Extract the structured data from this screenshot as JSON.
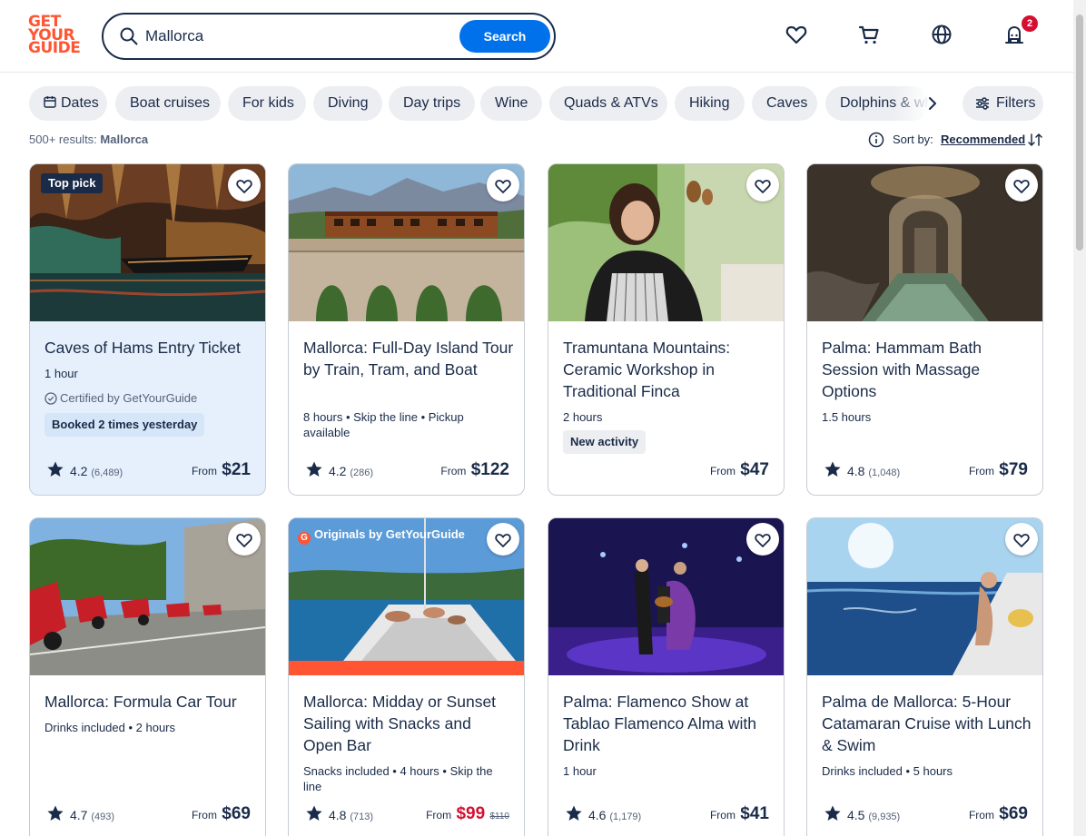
{
  "header": {
    "logo_lines": [
      "GET",
      "YOUR",
      "GUIDE"
    ],
    "search_value": "Mallorca",
    "search_button": "Search",
    "cart_badge": "2",
    "icons": [
      "heart-icon",
      "cart-icon",
      "globe-icon",
      "profile-icon"
    ]
  },
  "filters": {
    "chips": [
      "Dates",
      "Boat cruises",
      "For kids",
      "Diving",
      "Day trips",
      "Wine",
      "Quads & ATVs",
      "Hiking",
      "Caves",
      "Dolphins & whales"
    ],
    "filters_label": "Filters"
  },
  "results": {
    "count": "500+ results:",
    "query": "Mallorca",
    "sort_label": "Sort by:",
    "sort_value": "Recommended"
  },
  "colors": {
    "brand": "#ff5533",
    "accent": "#0071eb",
    "text": "#1a2b49",
    "sale": "#d50f32"
  },
  "cards": [
    {
      "tag": "Top pick",
      "title": "Caves of Hams Entry Ticket",
      "meta": "1 hour",
      "certified": "Certified by GetYourGuide",
      "pill": "Booked 2 times yesterday",
      "rating": "4.2",
      "reviews": "(6,489)",
      "from": "From",
      "price": "$21"
    },
    {
      "title": "Mallorca: Full-Day Island Tour by Train, Tram, and Boat",
      "meta": "8 hours • Skip the line • Pickup available",
      "rating": "4.2",
      "reviews": "(286)",
      "from": "From",
      "price": "$122"
    },
    {
      "title": "Tramuntana Mountains: Ceramic Workshop in Traditional Finca",
      "meta": "2 hours",
      "pill": "New activity",
      "from": "From",
      "price": "$47"
    },
    {
      "title": "Palma: Hammam Bath Session with Massage Options",
      "meta": "1.5 hours",
      "rating": "4.8",
      "reviews": "(1,048)",
      "from": "From",
      "price": "$79"
    },
    {
      "title": "Mallorca: Formula Car Tour",
      "meta": "Drinks included • 2 hours",
      "rating": "4.7",
      "reviews": "(493)",
      "from": "From",
      "price": "$69"
    },
    {
      "tag": "Originals by GetYourGuide",
      "title": "Mallorca: Midday or Sunset Sailing with Snacks and Open Bar",
      "meta": "Snacks included • 4 hours • Skip the line",
      "rating": "4.8",
      "reviews": "(713)",
      "from": "From",
      "price": "$99",
      "old_price": "$110"
    },
    {
      "title": "Palma: Flamenco Show at Tablao Flamenco Alma with Drink",
      "meta": "1 hour",
      "rating": "4.6",
      "reviews": "(1,179)",
      "from": "From",
      "price": "$41"
    },
    {
      "title": "Palma de Mallorca: 5-Hour Catamaran Cruise with Lunch & Swim",
      "meta": "Drinks included • 5 hours",
      "rating": "4.5",
      "reviews": "(9,935)",
      "from": "From",
      "price": "$69"
    }
  ]
}
